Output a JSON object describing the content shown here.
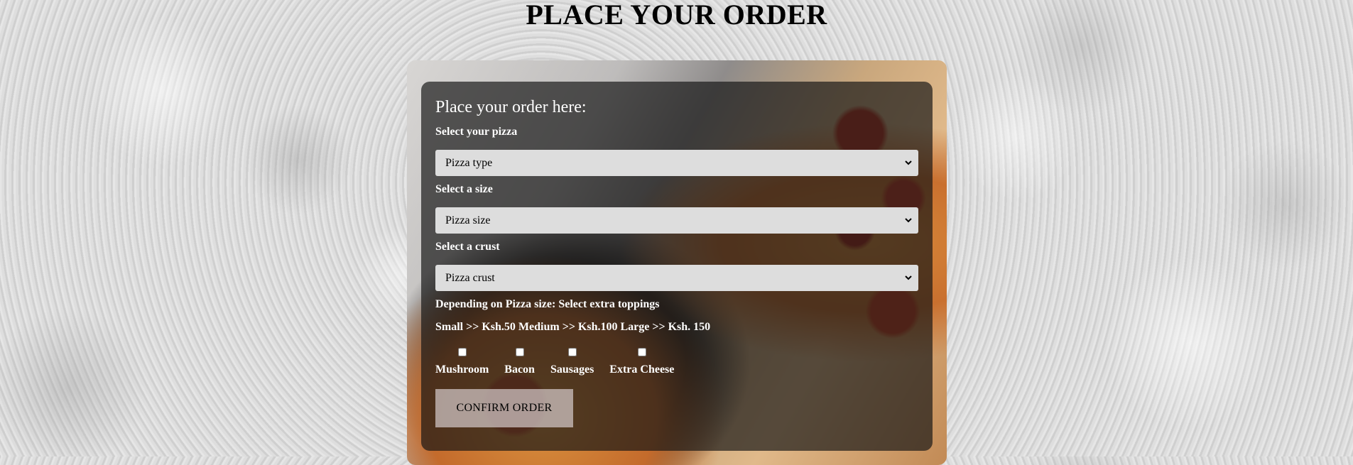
{
  "page": {
    "title": "PLACE YOUR ORDER"
  },
  "form": {
    "heading": "Place your order here:",
    "pizza_label": "Select your pizza",
    "pizza_select_value": "Pizza type",
    "size_label": "Select a size",
    "size_select_value": "Pizza size",
    "crust_label": "Select a crust",
    "crust_select_value": "Pizza crust",
    "toppings_label": "Depending on Pizza size: Select extra toppings",
    "toppings_prices": "Small >> Ksh.50 Medium >> Ksh.100 Large >> Ksh. 150",
    "toppings": [
      {
        "label": "Mushroom",
        "checked": false
      },
      {
        "label": "Bacon",
        "checked": false
      },
      {
        "label": "Sausages",
        "checked": false
      },
      {
        "label": "Extra Cheese",
        "checked": false
      }
    ],
    "confirm_label": "CONFIRM ORDER"
  },
  "colors": {
    "panel_overlay": "#141414",
    "select_background": "#dddddd",
    "button_background": "#d2c8c8"
  }
}
